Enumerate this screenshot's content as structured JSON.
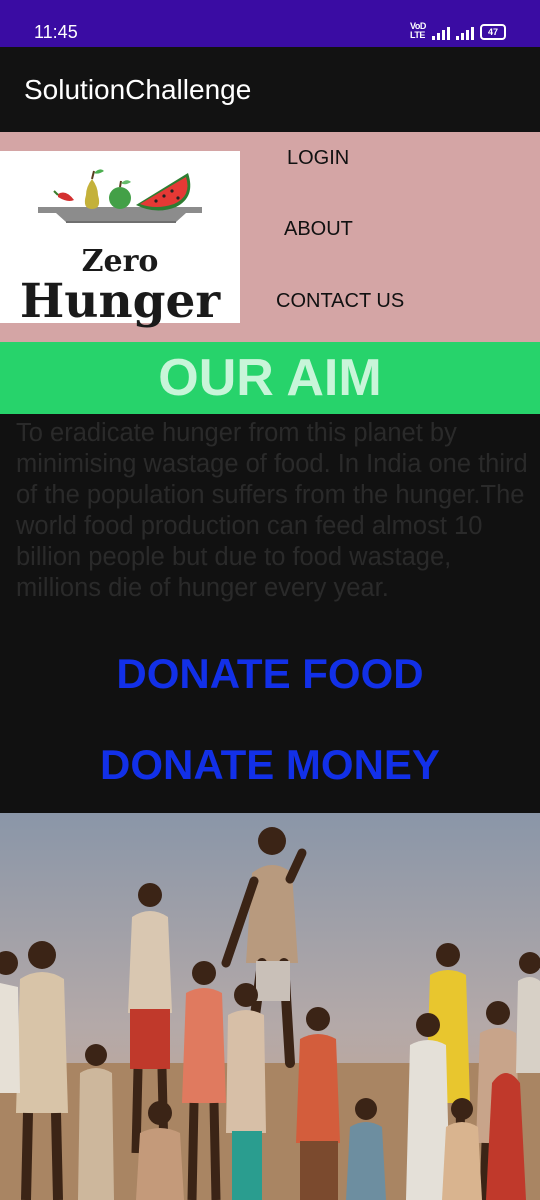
{
  "status_bar": {
    "time": "11:45",
    "network_label": "VoD LTE",
    "battery": "47"
  },
  "app_bar": {
    "title": "SolutionChallenge"
  },
  "logo": {
    "line1": "Zero",
    "line2": "Hunger"
  },
  "nav": {
    "login": "LOGIN",
    "about": "ABOUT",
    "contact": "CONTACT US"
  },
  "aim": {
    "title": "OUR AIM",
    "text": "To eradicate hunger from this planet by minimising wastage of food. In India one third of the population suffers from the hunger.The world food production can feed almost 10 billion people but due to food wastage, millions die of hunger every year."
  },
  "actions": {
    "donate_food": "DONATE FOOD",
    "donate_money": "DONATE MONEY"
  },
  "colors": {
    "status_bar": "#3a0ca3",
    "app_bar": "#121212",
    "header_bg": "#d4a5a5",
    "aim_bar": "#27d36b",
    "donate_text": "#1230e8"
  },
  "icons": [
    "signal-icon",
    "battery-icon",
    "pear-icon",
    "apple-icon",
    "watermelon-icon",
    "chili-icon"
  ]
}
